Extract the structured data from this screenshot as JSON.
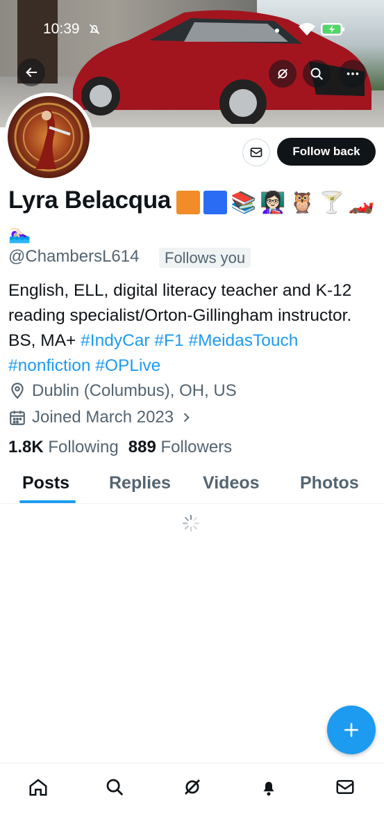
{
  "status_bar": {
    "time": "10:39"
  },
  "profile": {
    "name": "Lyra Belacqua",
    "name_emojis": [
      "🟧",
      "🟦",
      "📚",
      "👩🏻‍🏫",
      "🦉",
      "🍸",
      "🏎️"
    ],
    "name_emoji_line2": "🏊🏻‍♀️",
    "handle": "@ChambersL614",
    "follows_you": "Follows you",
    "bio_text": "English, ELL, digital literacy teacher and K-12 reading specialist/Orton-Gillingham instructor. BS, MA+ ",
    "bio_tags": [
      "#IndyCar",
      "#F1",
      "#MeidasTouch",
      "#nonfiction",
      "#OPLive"
    ],
    "location": "Dublin (Columbus), OH, US",
    "joined": "Joined March 2023",
    "following_count": "1.8K",
    "following_label": "Following",
    "followers_count": "889",
    "followers_label": "Followers"
  },
  "actions": {
    "follow_back": "Follow back"
  },
  "tabs": [
    {
      "label": "Posts",
      "active": true
    },
    {
      "label": "Replies",
      "active": false
    },
    {
      "label": "Videos",
      "active": false
    },
    {
      "label": "Photos",
      "active": false
    }
  ],
  "colors": {
    "accent": "#1d9bf0",
    "text": "#0f1419",
    "secondary": "#536471"
  },
  "bottom_nav": [
    "home-icon",
    "search-icon",
    "grok-icon",
    "notifications-icon",
    "messages-icon"
  ]
}
